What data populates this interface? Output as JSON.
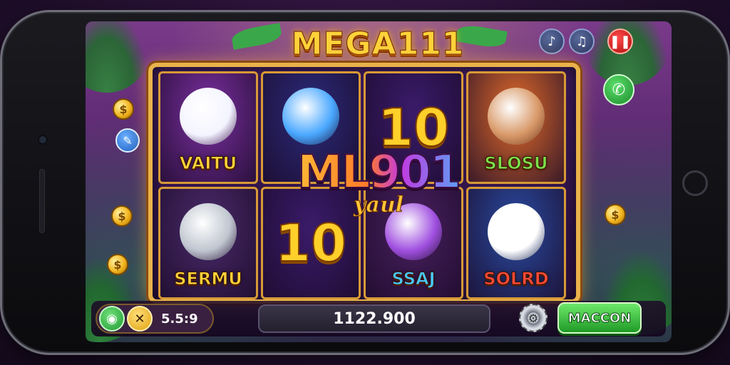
{
  "game": {
    "title": "MEGA111",
    "overlay_logo": "ML901",
    "overlay_sub": "yaul"
  },
  "reels": [
    {
      "label": "VAITU",
      "bg": "#7b2fa0",
      "art_color": "#f4f4ff",
      "label_color": "#ffd23a",
      "icon": "bear-icon"
    },
    {
      "label": "",
      "bg": "#2b2a7a",
      "art_color": "#4aa8ff",
      "label_color": "#ffffff",
      "icon": "key-icon"
    },
    {
      "label": "10",
      "bg": "#3a1b6a",
      "art_color": "",
      "label_color": "#ffcf2a",
      "icon": "ten-icon"
    },
    {
      "label": "SLOSU",
      "bg": "#e06a2a",
      "art_color": "#d99a6a",
      "label_color": "#7ae04a",
      "icon": "king-icon"
    },
    {
      "label": "SERMU",
      "bg": "#4a2a6a",
      "art_color": "#c0c6d0",
      "label_color": "#ffd23a",
      "icon": "barrel-man-icon"
    },
    {
      "label": "10",
      "bg": "#3a1b6a",
      "art_color": "",
      "label_color": "#ffcf2a",
      "icon": "ten-icon"
    },
    {
      "label": "SSAJ",
      "bg": "#4a2060",
      "art_color": "#a050e0",
      "label_color": "#4ac8ff",
      "icon": "cup-icon"
    },
    {
      "label": "SOLRD",
      "bg": "#2a4aa0",
      "art_color": "#ffffff",
      "label_color": "#ff4a3a",
      "icon": "husky-icon"
    }
  ],
  "bottom_bar": {
    "bet_value": "5.5:9",
    "balance": "1122.900",
    "action_label": "MACCON"
  },
  "icons": {
    "music": "music-icon",
    "sound": "sound-icon",
    "pause": "pause-icon",
    "phone": "phone-icon",
    "gear": "gear-icon",
    "location": "location-icon",
    "swap": "swap-icon",
    "wrench": "wrench-icon"
  },
  "colors": {
    "accent_gold": "#ffd23a",
    "frame_gold": "#e9b24a",
    "action_green": "#1f9a26",
    "pause_red": "#d01010"
  }
}
